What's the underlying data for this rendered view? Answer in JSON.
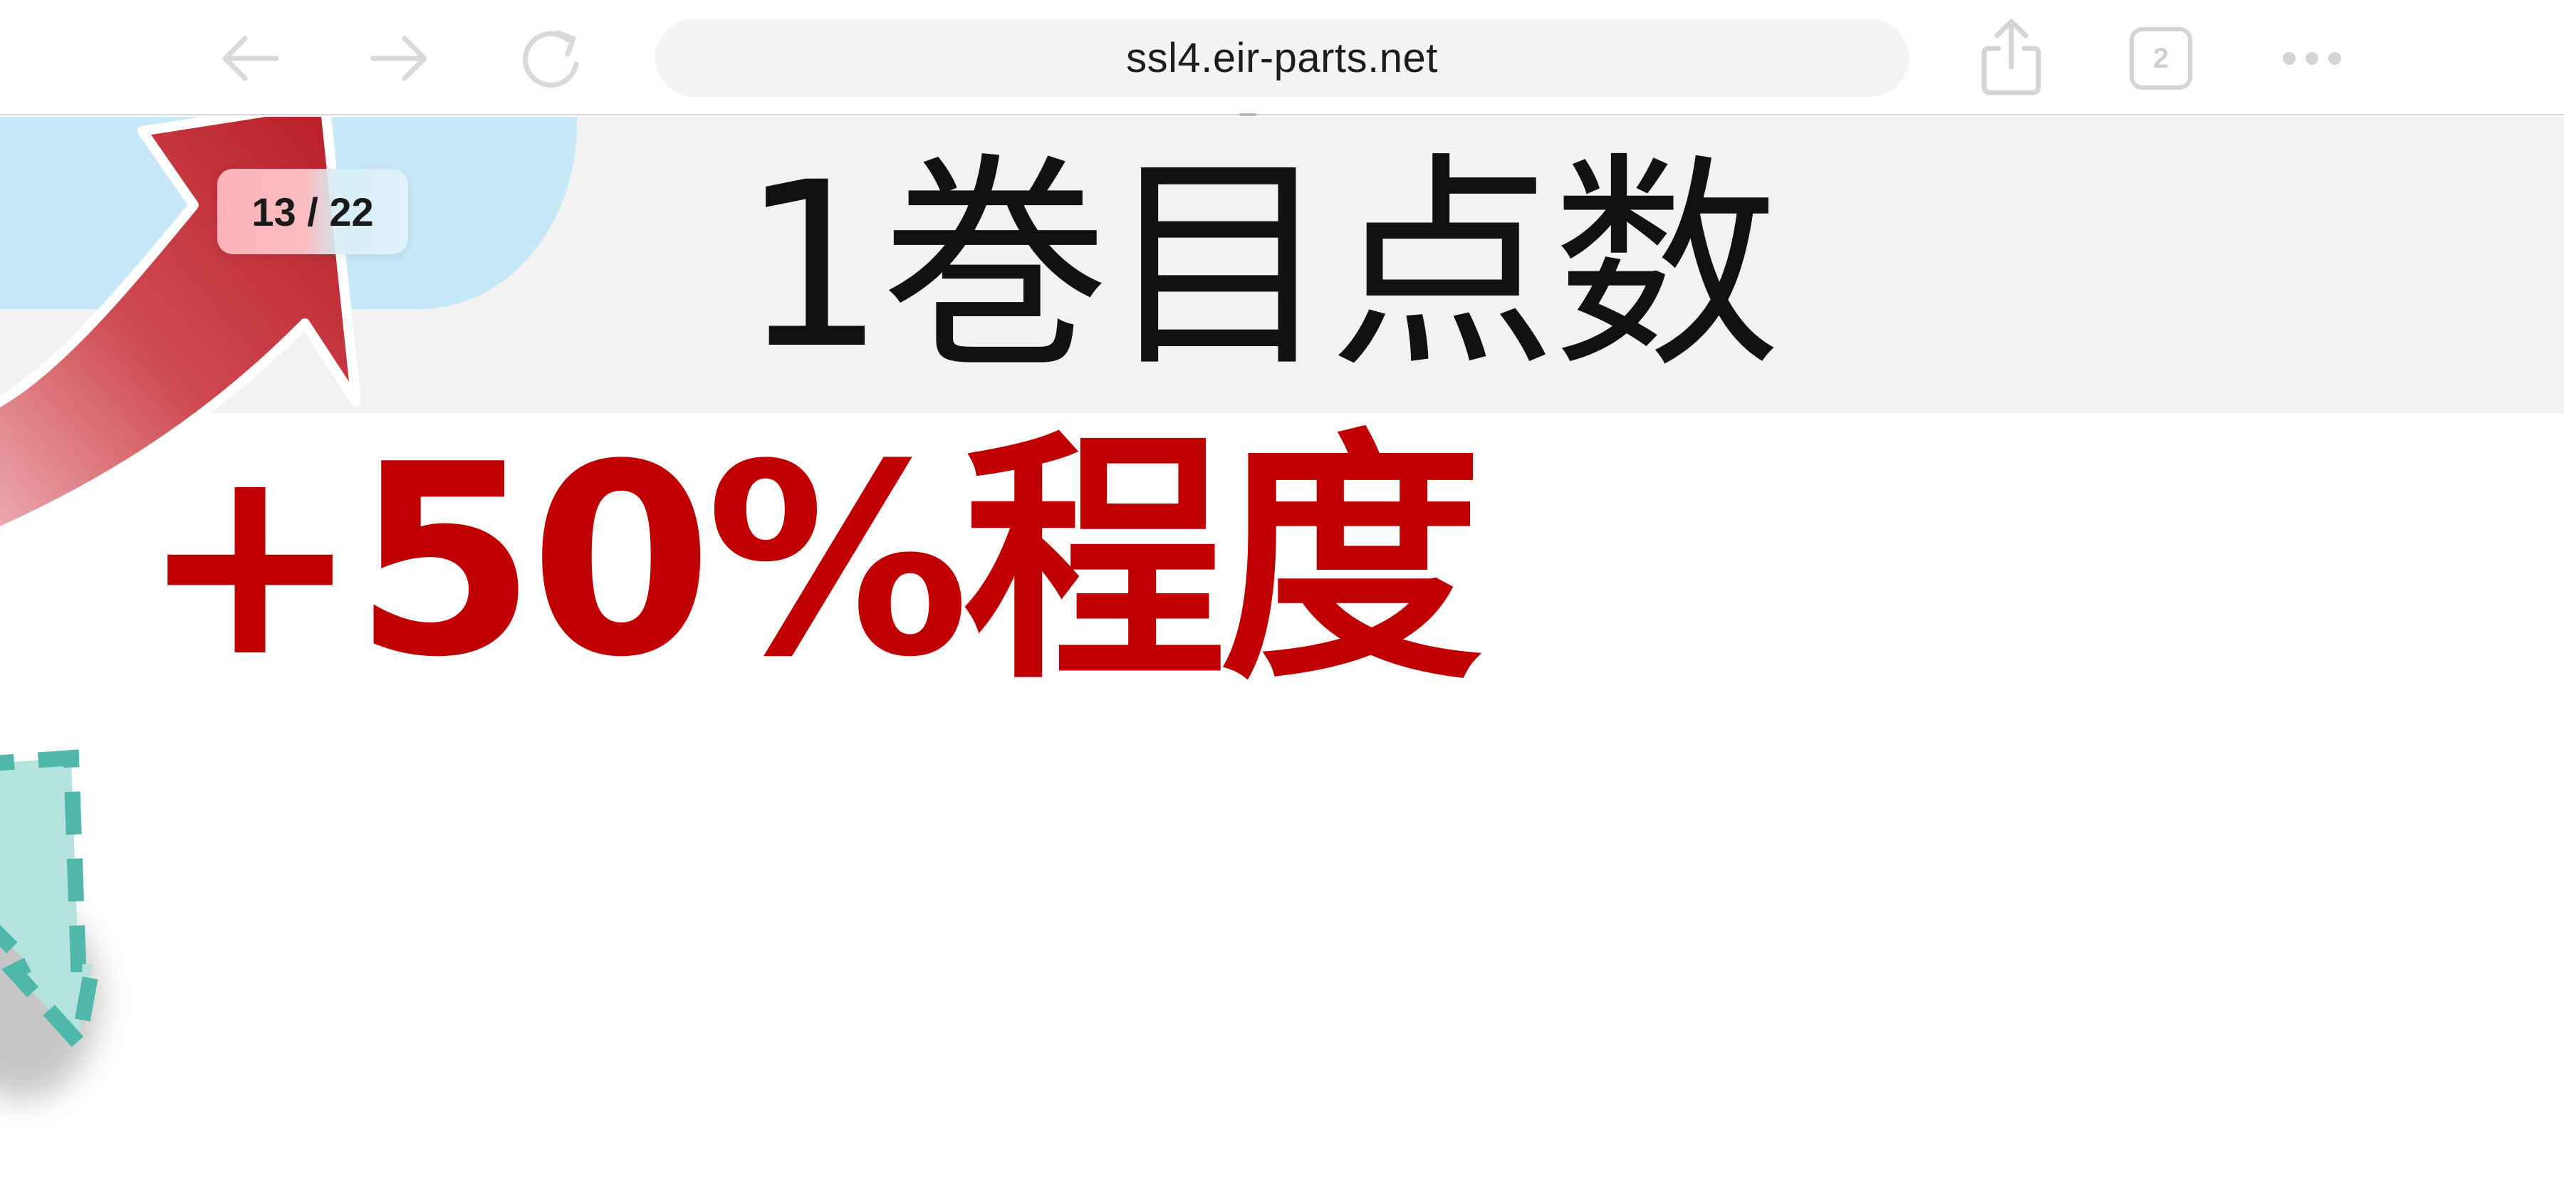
{
  "browser": {
    "url": "ssl4.eir-parts.net",
    "tab_count": "2",
    "buttons": {
      "back": "arrow-left-icon",
      "forward": "arrow-right-icon",
      "reload": "reload-icon",
      "share": "share-icon",
      "tabs": "tabs-icon",
      "more": "more-icon"
    }
  },
  "viewer": {
    "page_counter": "13 / 22"
  },
  "slide": {
    "title": "1巻目点数",
    "stat": "+50%程度",
    "colors": {
      "stat": "#c00000",
      "title_band": "#f2f2f2",
      "blue_blob": "#c6e8f8",
      "arrow": "#c0262c",
      "teal": "#4fb8aa"
    }
  }
}
